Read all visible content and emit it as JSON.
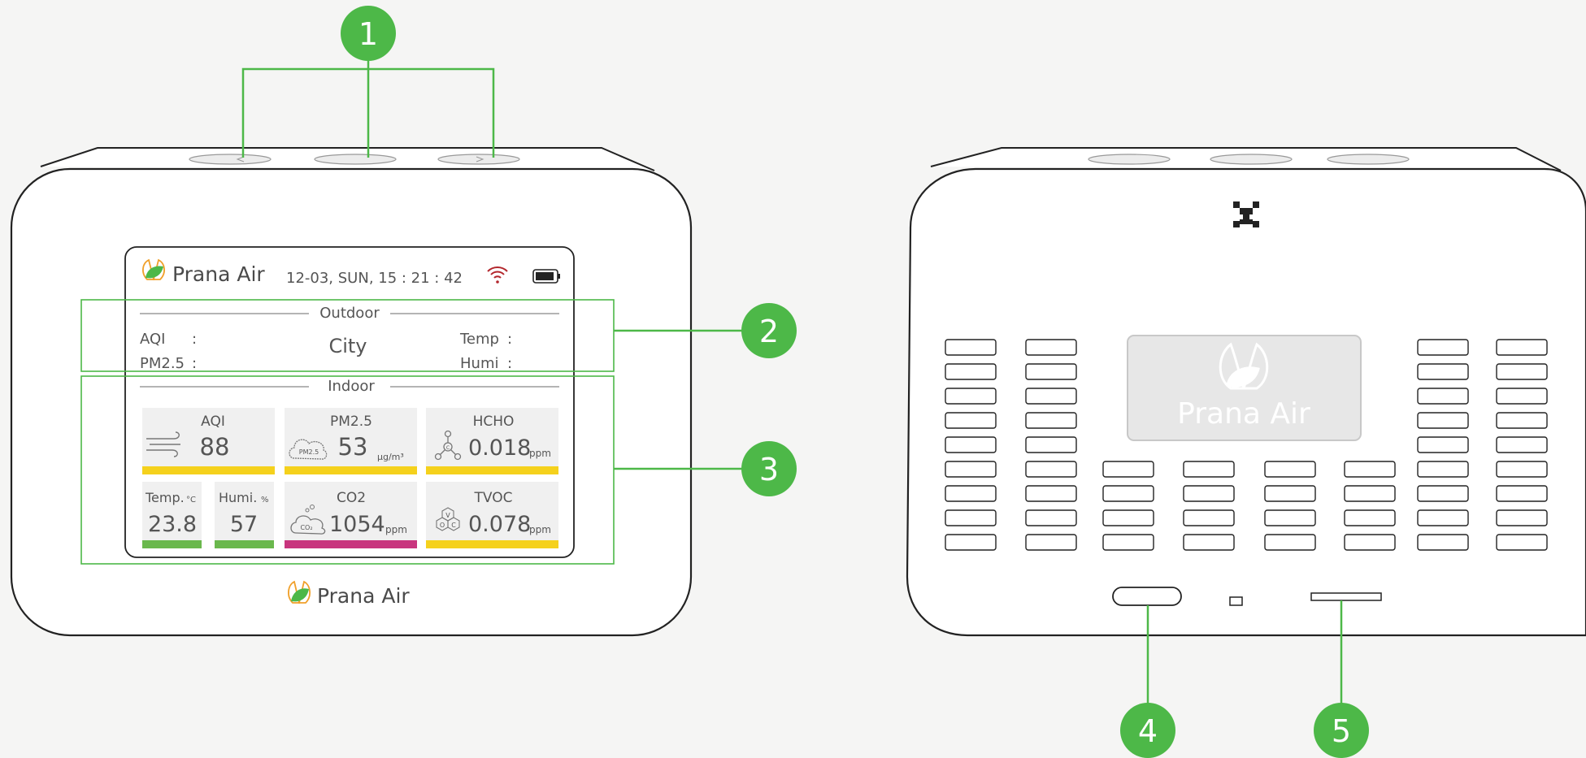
{
  "colors": {
    "callout_green": "#4db848",
    "bar_yellow": "#f5d11c",
    "bar_green": "#6ab84d",
    "bar_magenta": "#c8357e",
    "wifi_red": "#b3272d",
    "leaf_orange": "#f0a02a",
    "leaf_green": "#4db848"
  },
  "callouts": [
    "1",
    "2",
    "3",
    "4",
    "5"
  ],
  "brand": {
    "name": "Prana Air",
    "watermark": "Prana Air"
  },
  "screen": {
    "datetime": "12-03,  SUN,  15 : 21 : 42",
    "outdoor": {
      "title": "Outdoor",
      "city": "City",
      "aqi_label": "AQI",
      "pm25_label": "PM2.5",
      "temp_label": "Temp",
      "humi_label": "Humi",
      "colon": ":"
    },
    "indoor": {
      "title": "Indoor",
      "aqi": {
        "label": "AQI",
        "value": "88"
      },
      "pm25": {
        "label": "PM2.5",
        "value": "53",
        "unit": "μg/m³"
      },
      "hcho": {
        "label": "HCHO",
        "value": "0.018",
        "unit": "ppm"
      },
      "temp": {
        "label": "Temp.",
        "unit": "°C",
        "value": "23.8"
      },
      "humi": {
        "label": "Humi.",
        "unit": "%",
        "value": "57"
      },
      "co2": {
        "label": "CO2",
        "value": "1054",
        "unit": "ppm"
      },
      "tvoc": {
        "label": "TVOC",
        "value": "0.078",
        "unit": "ppm"
      }
    },
    "icon_text": {
      "pm25_cloud": "PM2.5",
      "co2_cloud": "CO₂",
      "voc": [
        "V",
        "O",
        "C"
      ],
      "hcho_c": "C"
    }
  },
  "icons": [
    "leaf-logo-icon",
    "wifi-icon",
    "battery-icon",
    "wind-icon",
    "molecule-icon",
    "qr-code-icon"
  ]
}
